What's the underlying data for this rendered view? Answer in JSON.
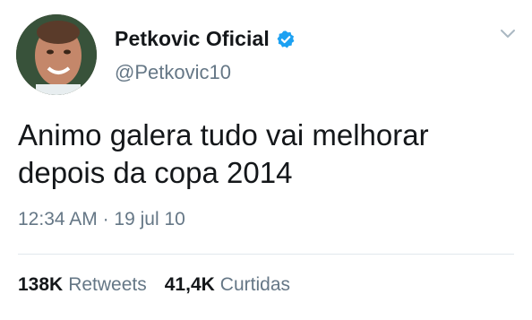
{
  "user": {
    "display_name": "Petkovic Oficial",
    "handle": "@Petkovic10",
    "verified_icon": "verified-badge-icon",
    "avatar": "profile-avatar"
  },
  "tweet": {
    "lines": [
      "Animo galera tudo vai melhorar",
      "depois da copa 2014"
    ],
    "time": "12:34 AM",
    "separator": "·",
    "date": "19 jul 10"
  },
  "stats": {
    "retweets_count": "138K",
    "retweets_label": "Retweets",
    "likes_count": "41,4K",
    "likes_label": "Curtidas"
  },
  "colors": {
    "verified_blue": "#1da1f2",
    "secondary_text": "#657786",
    "primary_text": "#14171a",
    "divider": "#e1e8ed"
  },
  "icons": {
    "menu": "chevron-down-icon"
  }
}
